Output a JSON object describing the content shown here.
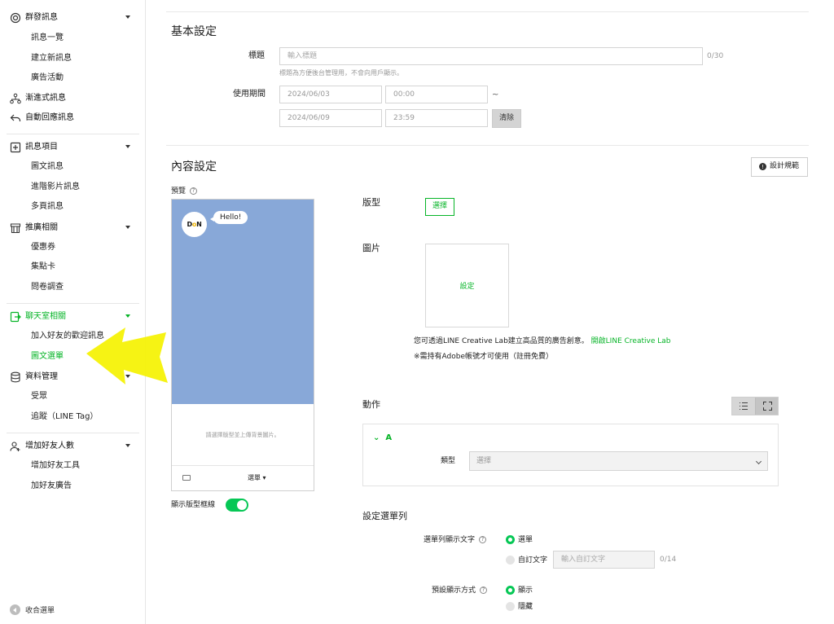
{
  "sidebar": {
    "groups": [
      {
        "label": "群發訊息",
        "icon": "broadcast-icon",
        "items": [
          "訊息一覽",
          "建立新訊息",
          "廣告活動"
        ]
      },
      {
        "label": "漸進式訊息",
        "icon": "step-message-icon"
      },
      {
        "label": "自動回應訊息",
        "icon": "auto-reply-icon"
      },
      {
        "label": "訊息項目",
        "icon": "message-items-icon",
        "items": [
          "圖文訊息",
          "進階影片訊息",
          "多頁訊息"
        ]
      },
      {
        "label": "推廣相關",
        "icon": "promotion-icon",
        "items": [
          "優惠券",
          "集點卡",
          "問卷調查"
        ]
      },
      {
        "label": "聊天室相關",
        "icon": "chat-room-icon",
        "items": [
          "加入好友的歡迎訊息",
          "圖文選單"
        ]
      },
      {
        "label": "資料管理",
        "icon": "data-management-icon",
        "items": [
          "受眾",
          "追蹤（LINE Tag）"
        ]
      },
      {
        "label": "增加好友人數",
        "icon": "add-friends-icon",
        "items": [
          "增加好友工具",
          "加好友廣告"
        ]
      }
    ],
    "collapse_label": "收合選單"
  },
  "basic": {
    "title": "基本設定",
    "title_label": "標題",
    "title_placeholder": "輸入標題",
    "title_counter": "0/30",
    "title_helper": "標題為方便後台管理用，不會向用戶顯示。",
    "period_label": "使用期間",
    "start_date": "2024/06/03",
    "start_time": "00:00",
    "tilde": "~",
    "end_date": "2024/06/09",
    "end_time": "23:59",
    "clear_button": "清除"
  },
  "content": {
    "title": "內容設定",
    "design_guide_button": "設計規範",
    "preview_label": "預覽",
    "preview": {
      "avatar_text_a": "D",
      "avatar_text_b": "N",
      "avatar_text_c": "o",
      "bubble": "Hello!",
      "placeholder": "請選擇版型並上傳背景圖片。",
      "menu_label": "選單 ▾"
    },
    "show_template_border_label": "顯示版型框線",
    "template_label": "版型",
    "template_button": "選擇",
    "image_label": "圖片",
    "image_set_button": "設定",
    "creative_text": "您可透過LINE Creative Lab建立高品質的廣告創意。",
    "creative_link": "開啟LINE Creative Lab",
    "adobe_note": "※需持有Adobe帳號才可使用（註冊免費）",
    "action_label": "動作",
    "action_a_label": "A",
    "type_label": "類型",
    "type_select_value": "選擇"
  },
  "menu_bar": {
    "title": "設定選單列",
    "display_text_label": "選單列顯示文字",
    "option_menu": "選單",
    "option_custom": "自訂文字",
    "custom_placeholder": "輸入自訂文字",
    "custom_counter": "0/14",
    "default_display_label": "預設顯示方式",
    "option_show": "顯示",
    "option_hide": "隱藏"
  },
  "colors": {
    "accent": "#06c755",
    "preview_bg": "#88a8d8",
    "annotation_arrow": "#f5f200"
  }
}
